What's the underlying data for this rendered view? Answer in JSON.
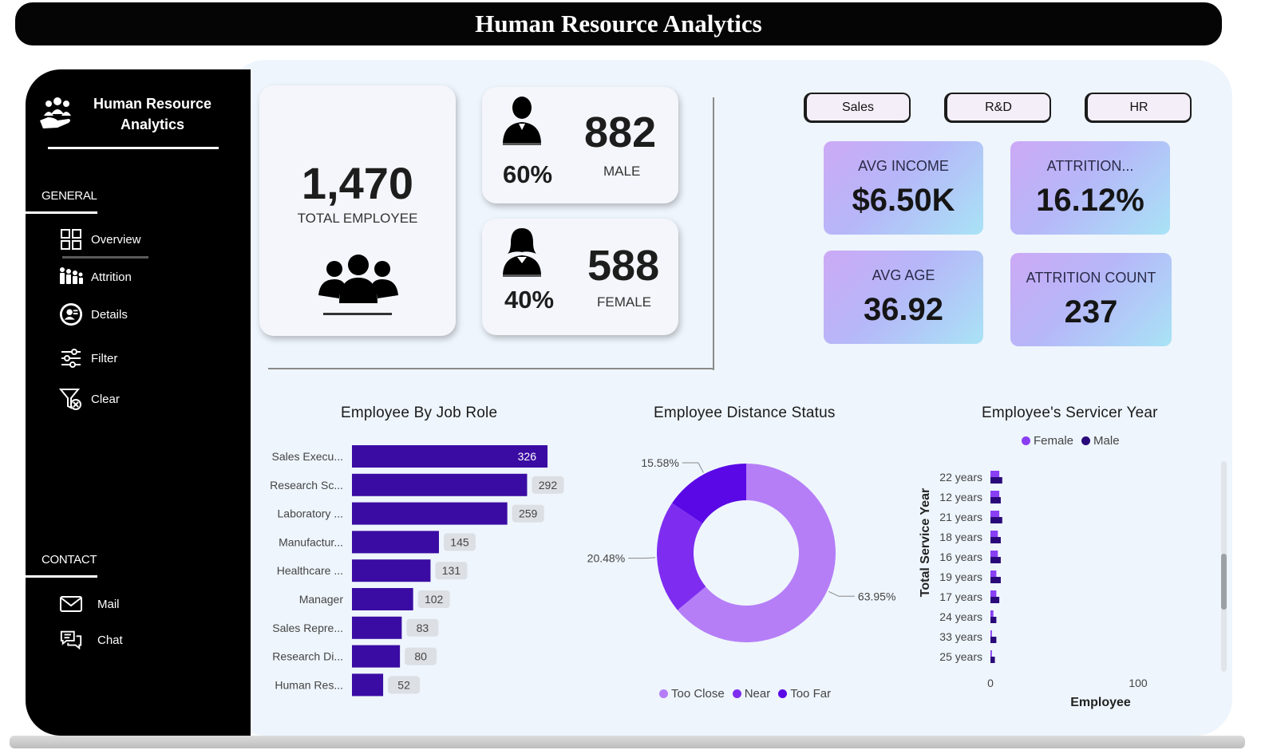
{
  "header": {
    "title": "Human Resource Analytics"
  },
  "sidebar": {
    "brand": "Human Resource Analytics",
    "general_label": "GENERAL",
    "contact_label": "CONTACT",
    "nav": [
      {
        "label": "Overview",
        "icon": "grid-icon"
      },
      {
        "label": "Attrition",
        "icon": "people-attrition-icon"
      },
      {
        "label": "Details",
        "icon": "profile-details-icon"
      },
      {
        "label": "Filter",
        "icon": "sliders-icon"
      },
      {
        "label": "Clear",
        "icon": "clear-filter-icon"
      }
    ],
    "contact": [
      {
        "label": "Mail",
        "icon": "mail-icon"
      },
      {
        "label": "Chat",
        "icon": "chat-icon"
      }
    ]
  },
  "kpis": {
    "total_employee": {
      "value": "1,470",
      "label": "TOTAL EMPLOYEE"
    },
    "male": {
      "value": "882",
      "label": "MALE",
      "pct": "60%"
    },
    "female": {
      "value": "588",
      "label": "FEMALE",
      "pct": "40%"
    }
  },
  "departments": [
    "Sales",
    "R&D",
    "HR"
  ],
  "metrics": [
    {
      "label": "AVG INCOME",
      "value": "$6.50K"
    },
    {
      "label": "ATTRITION...",
      "value": "16.12%"
    },
    {
      "label": "AVG AGE",
      "value": "36.92"
    },
    {
      "label": "ATTRITION COUNT",
      "value": "237"
    }
  ],
  "colors": {
    "bar": "#3a0ca3",
    "too_close": "#b57ef7",
    "near": "#7e2df0",
    "too_far": "#5a08e6",
    "female": "#8a3ff5",
    "male": "#2a0a7a"
  },
  "chart_data": [
    {
      "type": "bar",
      "title": "Employee By Job Role",
      "categories": [
        "Sales Execu...",
        "Research Sc...",
        "Laboratory ...",
        "Manufactur...",
        "Healthcare ...",
        "Manager",
        "Sales Repre...",
        "Research Di...",
        "Human Res..."
      ],
      "values": [
        326,
        292,
        259,
        145,
        131,
        102,
        83,
        80,
        52
      ],
      "orientation": "horizontal",
      "xlim": [
        0,
        326
      ]
    },
    {
      "type": "pie",
      "title": "Employee Distance Status",
      "donut": true,
      "categories": [
        "Too Close",
        "Near",
        "Too Far"
      ],
      "values": [
        63.95,
        20.48,
        15.58
      ],
      "labels": [
        "63.95%",
        "20.48%",
        "15.58%"
      ],
      "legend": "bottom"
    },
    {
      "type": "bar",
      "title": "Employee's Servicer Year",
      "orientation": "horizontal",
      "categories": [
        "22 years",
        "12 years",
        "21 years",
        "18 years",
        "16 years",
        "19 years",
        "17 years",
        "24 years",
        "33 years",
        "25 years"
      ],
      "series": [
        {
          "name": "Female",
          "values": [
            6,
            6,
            6,
            5,
            5,
            4,
            4,
            2,
            1,
            1
          ]
        },
        {
          "name": "Male",
          "values": [
            8,
            7,
            8,
            7,
            7,
            7,
            6,
            4,
            4,
            3
          ]
        }
      ],
      "xlabel": "Employee",
      "ylabel": "Total Service Year",
      "xticks": [
        "0",
        "100"
      ],
      "xlim": [
        0,
        100
      ],
      "legend": "top"
    }
  ]
}
